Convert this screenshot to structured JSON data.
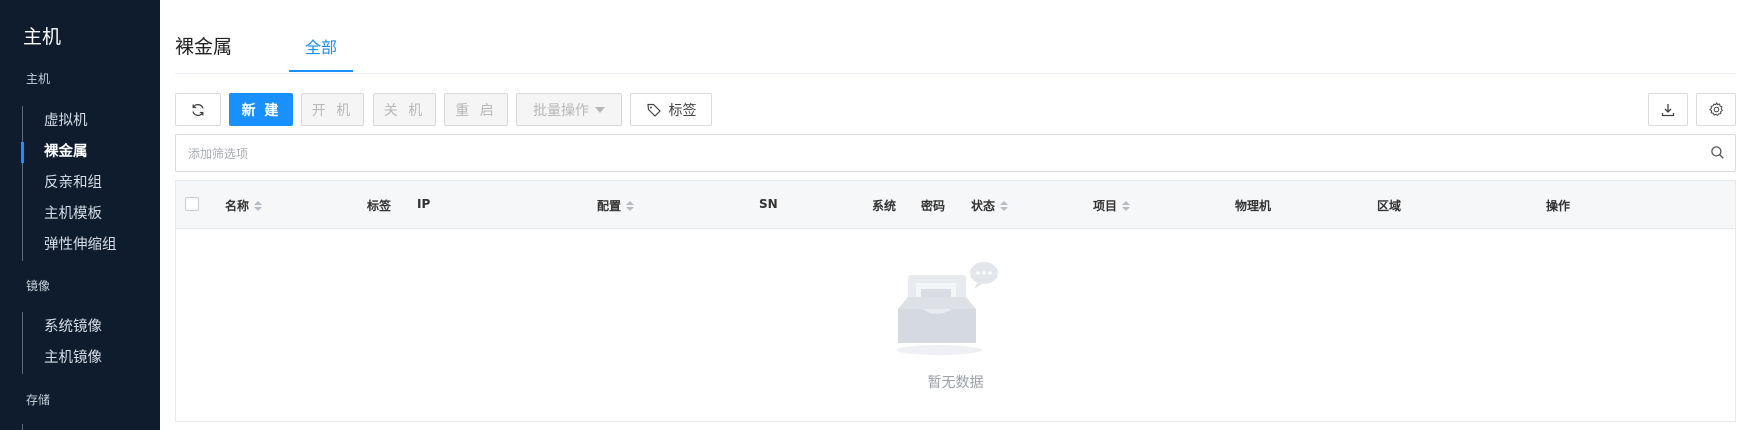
{
  "sidebar": {
    "title": "主机",
    "groups": [
      {
        "label": "主机",
        "items": [
          "虚拟机",
          "裸金属",
          "反亲和组",
          "主机模板",
          "弹性伸缩组"
        ],
        "active_index": 1
      },
      {
        "label": "镜像",
        "items": [
          "系统镜像",
          "主机镜像"
        ]
      },
      {
        "label": "存储"
      }
    ]
  },
  "page": {
    "title": "裸金属",
    "tab": "全部"
  },
  "toolbar": {
    "refresh_icon": "refresh-icon",
    "new_label": "新 建",
    "power_on_label": "开 机",
    "power_off_label": "关 机",
    "restart_label": "重 启",
    "batch_label": "批量操作",
    "tag_label": "标签",
    "download_icon": "download-icon",
    "settings_icon": "gear-icon"
  },
  "search": {
    "placeholder": "添加筛选项"
  },
  "table": {
    "columns": [
      "名称",
      "标签",
      "IP",
      "配置",
      "SN",
      "系统",
      "密码",
      "状态",
      "项目",
      "物理机",
      "区域",
      "操作"
    ],
    "sortable": [
      "名称",
      "配置",
      "状态",
      "项目"
    ],
    "empty_text": "暂无数据"
  },
  "colors": {
    "accent": "#1890ff",
    "sidebar_bg": "#0e1c2e"
  }
}
